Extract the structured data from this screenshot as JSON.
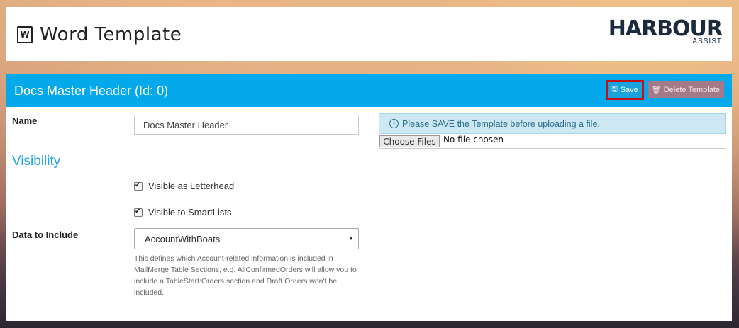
{
  "header": {
    "title": "Word Template",
    "icon": "word-document-icon",
    "logo": {
      "main": "HARBOUR",
      "sub": "ASSIST"
    }
  },
  "panel": {
    "title": "Docs Master Header (Id: 0)",
    "save_label": "Save",
    "delete_label": "Delete Template",
    "accent_color": "#03a9ea"
  },
  "form": {
    "name_label": "Name",
    "name_value": "Docs Master Header",
    "visibility_heading": "Visibility",
    "visible_letterhead_label": "Visible as Letterhead",
    "visible_letterhead_checked": true,
    "visible_smartlists_label": "Visible to SmartLists",
    "visible_smartlists_checked": true,
    "data_to_include_label": "Data to Include",
    "data_to_include_value": "AccountWithBoats",
    "help_text": "This defines which Account-related information is included in MailMerge Table Sections, e.g. AllConfirmedOrders will allow you to include a TableStart:Orders section and Draft Orders won't be included."
  },
  "upload": {
    "alert_text": "Please SAVE the Template before uploading a file.",
    "choose_files_label": "Choose Files",
    "no_file_text": "No file chosen"
  }
}
